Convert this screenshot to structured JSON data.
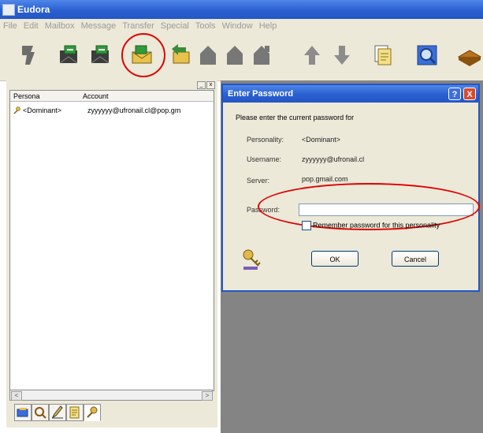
{
  "window": {
    "title": "Eudora"
  },
  "menu": [
    "File",
    "Edit",
    "Mailbox",
    "Message",
    "Transfer",
    "Special",
    "Tools",
    "Window",
    "Help"
  ],
  "toolbar": {
    "icons": [
      "delete-icon",
      "check-mail-icon",
      "send-queued-icon",
      "new-message-icon",
      "reply-icon",
      "reply-all-icon",
      "forward-icon",
      "redirect-icon",
      "previous-icon",
      "next-icon",
      "attach-icon",
      "find-icon",
      "address-book-icon"
    ]
  },
  "pane": {
    "controls": [
      "_",
      "x"
    ],
    "columns": [
      "Persona",
      "Account"
    ],
    "rows": [
      {
        "persona": "<Dominant>",
        "account": "zyyyyyy@ufronail.cl@pop.gm"
      }
    ],
    "scroll_left": "<",
    "scroll_right": ">"
  },
  "dialog": {
    "title": "Enter Password",
    "help": "?",
    "close": "X",
    "prompt": "Please enter the current password for",
    "personality_label": "Personality:",
    "personality_value": "<Dominant>",
    "username_label": "Username:",
    "username_value": "zyyyyyy@ufronail.cl",
    "server_label": "Server:",
    "server_value": "pop.gmail.com",
    "password_label": "Password:",
    "password_value": "",
    "remember_label": "Remember password for this personality",
    "remember_checked": false,
    "ok": "OK",
    "cancel": "Cancel"
  },
  "colors": {
    "highlight": "#e00000",
    "titlebar": "#2a5fd0",
    "workspace": "#848484"
  }
}
